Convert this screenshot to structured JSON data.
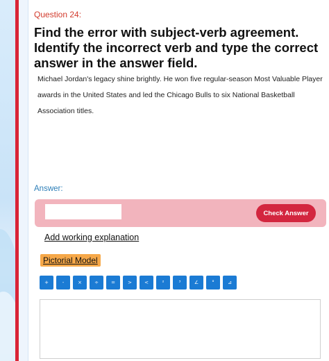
{
  "question": {
    "number_label": "Question 24:",
    "title": "Find the error with subject-verb agreement. Identify the incorrect verb and type the correct answer in the answer field.",
    "body": "Michael Jordan's legacy shine brightly. He won five regular-season Most Valuable Player awards in the United States and led the Chicago Bulls to six National Basketball Association titles."
  },
  "answer": {
    "label": "Answer:",
    "input_value": "",
    "check_button_label": "Check Answer"
  },
  "links": {
    "add_working_explanation": "Add working explanation",
    "pictorial_model": "Pictorial Model"
  },
  "toolbar": {
    "buttons": [
      "+",
      "-",
      "×",
      "÷",
      "=",
      ">",
      "<",
      "²",
      "³",
      "∠",
      "°",
      "⊿"
    ]
  },
  "work_area": {
    "value": ""
  },
  "colors": {
    "accent_red": "#d3263f",
    "answer_panel": "#f2b4bd",
    "question_number": "#d23a2c",
    "answer_label": "#2e7fb8",
    "toolbar_blue": "#1b7bd4",
    "pictorial_orange": "#f6a849"
  }
}
